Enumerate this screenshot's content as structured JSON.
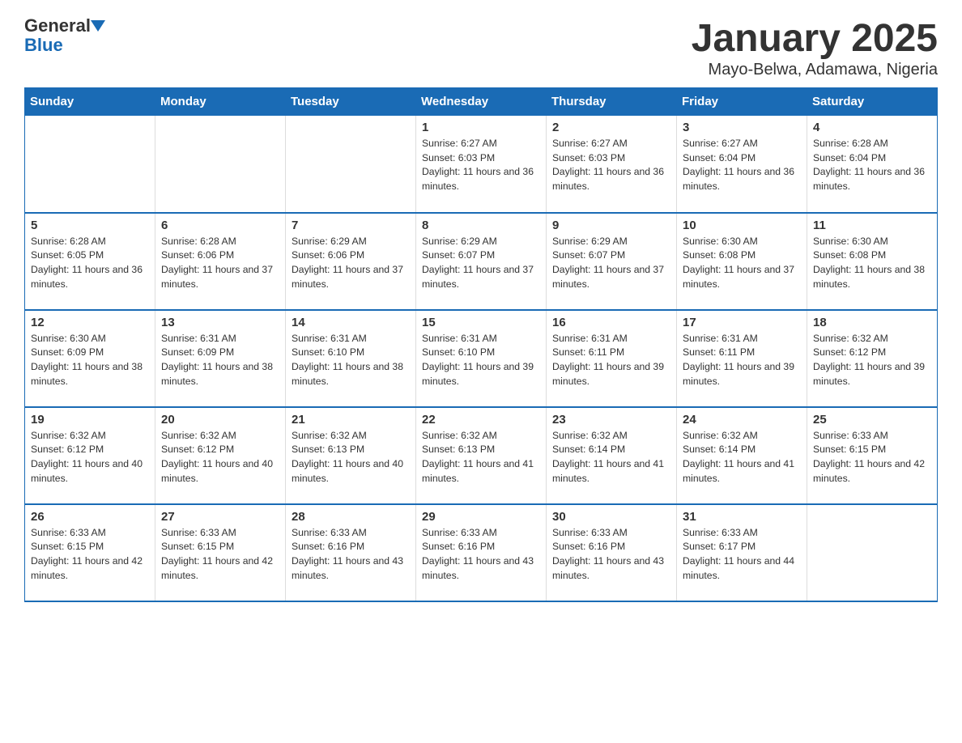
{
  "header": {
    "logo_general": "General",
    "logo_blue": "Blue",
    "title": "January 2025",
    "subtitle": "Mayo-Belwa, Adamawa, Nigeria"
  },
  "days_of_week": [
    "Sunday",
    "Monday",
    "Tuesday",
    "Wednesday",
    "Thursday",
    "Friday",
    "Saturday"
  ],
  "weeks": [
    [
      {
        "day": "",
        "info": ""
      },
      {
        "day": "",
        "info": ""
      },
      {
        "day": "",
        "info": ""
      },
      {
        "day": "1",
        "info": "Sunrise: 6:27 AM\nSunset: 6:03 PM\nDaylight: 11 hours and 36 minutes."
      },
      {
        "day": "2",
        "info": "Sunrise: 6:27 AM\nSunset: 6:03 PM\nDaylight: 11 hours and 36 minutes."
      },
      {
        "day": "3",
        "info": "Sunrise: 6:27 AM\nSunset: 6:04 PM\nDaylight: 11 hours and 36 minutes."
      },
      {
        "day": "4",
        "info": "Sunrise: 6:28 AM\nSunset: 6:04 PM\nDaylight: 11 hours and 36 minutes."
      }
    ],
    [
      {
        "day": "5",
        "info": "Sunrise: 6:28 AM\nSunset: 6:05 PM\nDaylight: 11 hours and 36 minutes."
      },
      {
        "day": "6",
        "info": "Sunrise: 6:28 AM\nSunset: 6:06 PM\nDaylight: 11 hours and 37 minutes."
      },
      {
        "day": "7",
        "info": "Sunrise: 6:29 AM\nSunset: 6:06 PM\nDaylight: 11 hours and 37 minutes."
      },
      {
        "day": "8",
        "info": "Sunrise: 6:29 AM\nSunset: 6:07 PM\nDaylight: 11 hours and 37 minutes."
      },
      {
        "day": "9",
        "info": "Sunrise: 6:29 AM\nSunset: 6:07 PM\nDaylight: 11 hours and 37 minutes."
      },
      {
        "day": "10",
        "info": "Sunrise: 6:30 AM\nSunset: 6:08 PM\nDaylight: 11 hours and 37 minutes."
      },
      {
        "day": "11",
        "info": "Sunrise: 6:30 AM\nSunset: 6:08 PM\nDaylight: 11 hours and 38 minutes."
      }
    ],
    [
      {
        "day": "12",
        "info": "Sunrise: 6:30 AM\nSunset: 6:09 PM\nDaylight: 11 hours and 38 minutes."
      },
      {
        "day": "13",
        "info": "Sunrise: 6:31 AM\nSunset: 6:09 PM\nDaylight: 11 hours and 38 minutes."
      },
      {
        "day": "14",
        "info": "Sunrise: 6:31 AM\nSunset: 6:10 PM\nDaylight: 11 hours and 38 minutes."
      },
      {
        "day": "15",
        "info": "Sunrise: 6:31 AM\nSunset: 6:10 PM\nDaylight: 11 hours and 39 minutes."
      },
      {
        "day": "16",
        "info": "Sunrise: 6:31 AM\nSunset: 6:11 PM\nDaylight: 11 hours and 39 minutes."
      },
      {
        "day": "17",
        "info": "Sunrise: 6:31 AM\nSunset: 6:11 PM\nDaylight: 11 hours and 39 minutes."
      },
      {
        "day": "18",
        "info": "Sunrise: 6:32 AM\nSunset: 6:12 PM\nDaylight: 11 hours and 39 minutes."
      }
    ],
    [
      {
        "day": "19",
        "info": "Sunrise: 6:32 AM\nSunset: 6:12 PM\nDaylight: 11 hours and 40 minutes."
      },
      {
        "day": "20",
        "info": "Sunrise: 6:32 AM\nSunset: 6:12 PM\nDaylight: 11 hours and 40 minutes."
      },
      {
        "day": "21",
        "info": "Sunrise: 6:32 AM\nSunset: 6:13 PM\nDaylight: 11 hours and 40 minutes."
      },
      {
        "day": "22",
        "info": "Sunrise: 6:32 AM\nSunset: 6:13 PM\nDaylight: 11 hours and 41 minutes."
      },
      {
        "day": "23",
        "info": "Sunrise: 6:32 AM\nSunset: 6:14 PM\nDaylight: 11 hours and 41 minutes."
      },
      {
        "day": "24",
        "info": "Sunrise: 6:32 AM\nSunset: 6:14 PM\nDaylight: 11 hours and 41 minutes."
      },
      {
        "day": "25",
        "info": "Sunrise: 6:33 AM\nSunset: 6:15 PM\nDaylight: 11 hours and 42 minutes."
      }
    ],
    [
      {
        "day": "26",
        "info": "Sunrise: 6:33 AM\nSunset: 6:15 PM\nDaylight: 11 hours and 42 minutes."
      },
      {
        "day": "27",
        "info": "Sunrise: 6:33 AM\nSunset: 6:15 PM\nDaylight: 11 hours and 42 minutes."
      },
      {
        "day": "28",
        "info": "Sunrise: 6:33 AM\nSunset: 6:16 PM\nDaylight: 11 hours and 43 minutes."
      },
      {
        "day": "29",
        "info": "Sunrise: 6:33 AM\nSunset: 6:16 PM\nDaylight: 11 hours and 43 minutes."
      },
      {
        "day": "30",
        "info": "Sunrise: 6:33 AM\nSunset: 6:16 PM\nDaylight: 11 hours and 43 minutes."
      },
      {
        "day": "31",
        "info": "Sunrise: 6:33 AM\nSunset: 6:17 PM\nDaylight: 11 hours and 44 minutes."
      },
      {
        "day": "",
        "info": ""
      }
    ]
  ]
}
